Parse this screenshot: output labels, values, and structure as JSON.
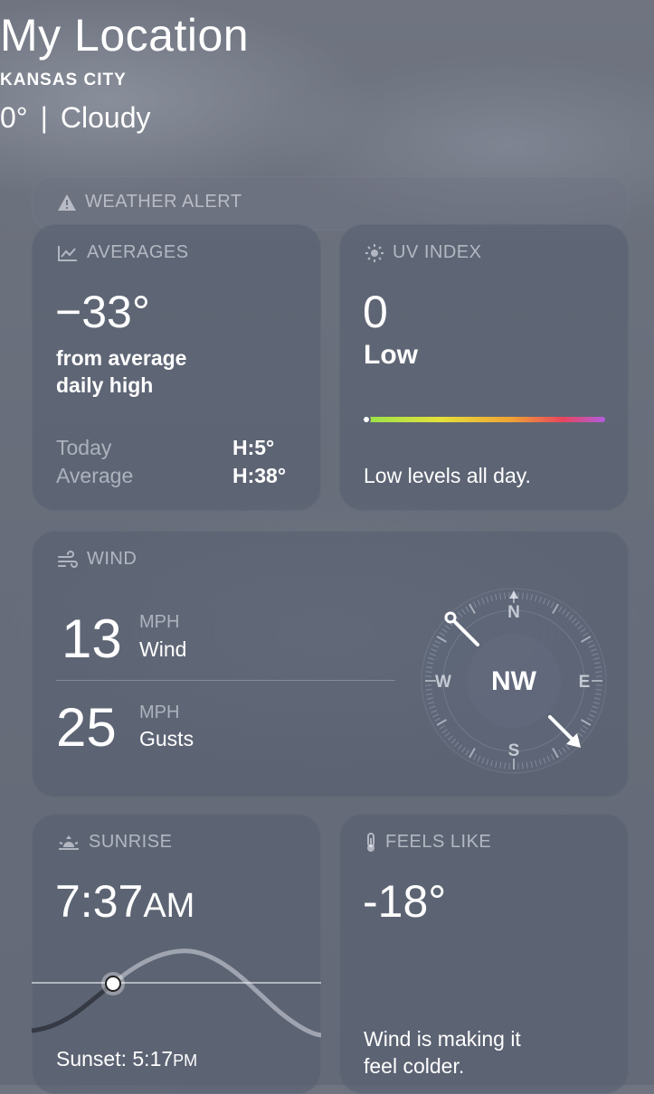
{
  "header": {
    "title": "My Location",
    "city": "KANSAS CITY",
    "temp": "0°",
    "separator": "|",
    "condition": "Cloudy"
  },
  "alert": {
    "label": "WEATHER ALERT",
    "icon": "warning-triangle-icon"
  },
  "averages": {
    "label": "AVERAGES",
    "icon": "trend-chart-icon",
    "value": "−33°",
    "desc_line1": "from average",
    "desc_line2": "daily high",
    "rows": [
      {
        "label": "Today",
        "value": "H:5°"
      },
      {
        "label": "Average",
        "value": "H:38°"
      }
    ]
  },
  "uv": {
    "label": "UV INDEX",
    "icon": "sun-icon",
    "value": "0",
    "level": "Low",
    "level_fraction": 0.0,
    "note": "Low levels all day.",
    "gradient": [
      "#9be24a",
      "#e5e13a",
      "#f0a334",
      "#e8455c",
      "#b25ce0"
    ]
  },
  "wind": {
    "label": "WIND",
    "icon": "wind-icon",
    "speed": "13",
    "speed_unit": "MPH",
    "speed_label": "Wind",
    "gust": "25",
    "gust_unit": "MPH",
    "gust_label": "Gusts",
    "direction": "NW",
    "compass": {
      "n": "N",
      "e": "E",
      "s": "S",
      "w": "W"
    }
  },
  "sunrise": {
    "label": "SUNRISE",
    "icon": "sunrise-icon",
    "time": "7:37",
    "ampm": "AM",
    "sunset_label": "Sunset: 5:17",
    "sunset_ampm": "PM"
  },
  "feels_like": {
    "label": "FEELS LIKE",
    "icon": "thermometer-icon",
    "value": "-18°",
    "note_line1": "Wind is making it",
    "note_line2": "feel colder."
  }
}
